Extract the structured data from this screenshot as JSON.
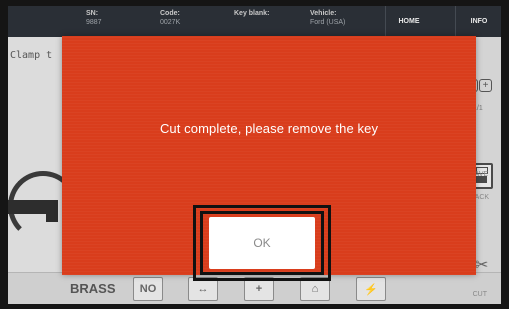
{
  "topbar": {
    "columns": [
      {
        "label": "SN:",
        "value": "9887"
      },
      {
        "label": "Code:",
        "value": "0027K"
      },
      {
        "label": "Key blank:",
        "value": ""
      },
      {
        "label": "Vehicle:",
        "value": "Ford (USA)"
      }
    ],
    "home_label": "HOME",
    "info_label": "INFO"
  },
  "background": {
    "clamp_label": "Clamp t",
    "page_indicator": "1/1",
    "save_label": "SAVE",
    "back_label": "BACK",
    "material_label": "BRASS",
    "no_button_label": "NO",
    "cut_label": "CUT"
  },
  "modal": {
    "message": "Cut complete, please remove the key",
    "ok_label": "OK",
    "background_color": "#d93d1c"
  }
}
